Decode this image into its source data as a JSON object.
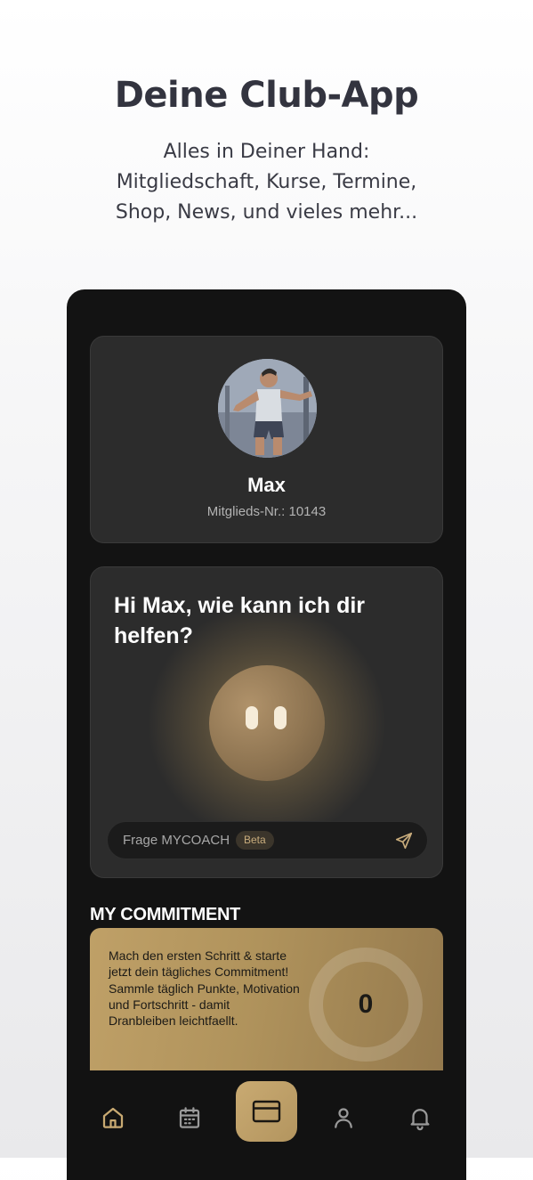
{
  "promo": {
    "title": "Deine Club-App",
    "subtitle_lines": [
      "Alles in Deiner Hand:",
      "Mitgliedschaft, Kurse, Termine,",
      "Shop, News, und vieles mehr..."
    ]
  },
  "profile": {
    "name": "Max",
    "member_number": "Mitglieds-Nr.: 10143"
  },
  "coach": {
    "greeting": "Hi Max, wie kann ich dir helfen?",
    "input_placeholder": "Frage MYCOACH",
    "beta_label": "Beta"
  },
  "commitment": {
    "section_title": "MY COMMITMENT",
    "description": "Mach den ersten Schritt & starte jetzt dein tägliches Commitment! Sammle täglich Punkte, Motivation und Fortschritt - damit Dranbleiben leichtfaellt.",
    "count": "0"
  },
  "tabbar": {
    "items": [
      {
        "icon": "home-icon",
        "active": true
      },
      {
        "icon": "calendar-icon",
        "active": false
      },
      {
        "icon": "membership-card-icon",
        "active": false
      },
      {
        "icon": "profile-icon",
        "active": false
      },
      {
        "icon": "bell-icon",
        "active": false
      }
    ]
  },
  "colors": {
    "accent_gold": "#c9aa72",
    "phone_bg": "#131313",
    "card_bg": "#2c2c2c",
    "headline": "#33343f"
  }
}
